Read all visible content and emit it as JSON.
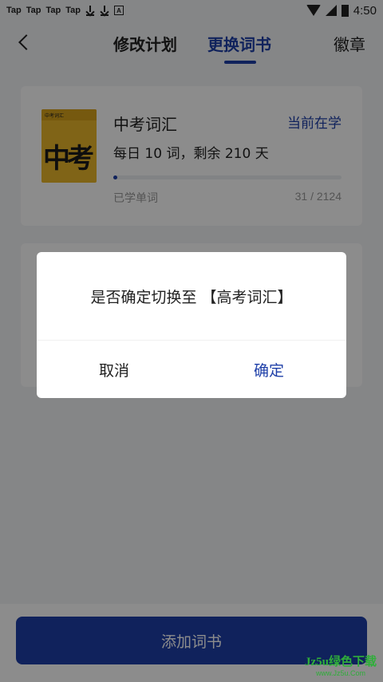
{
  "status_bar": {
    "apps": [
      "Tap",
      "Tap",
      "Tap",
      "Tap"
    ],
    "a_label": "A",
    "time": "4:50"
  },
  "header": {
    "tab_modify": "修改计划",
    "tab_change": "更换词书",
    "tab_badge": "徽章"
  },
  "book": {
    "cover_top_text": "中考词汇",
    "cover_big_text": "中考",
    "title": "中考词汇",
    "status": "当前在学",
    "daily": "每日 10 词，剩余 210 天",
    "learned_label": "已学单词",
    "learned_count": "31 / 2124",
    "progress": 0.0146
  },
  "dialog": {
    "message": "是否确定切换至 【高考词汇】",
    "cancel": "取消",
    "confirm": "确定"
  },
  "footer": {
    "add_button": "添加词书"
  },
  "watermark": {
    "line1": "Jz5u绿色下载",
    "line2": "www.Jz5u.Com"
  },
  "colors": {
    "accent": "#1e3fa8",
    "cover": "#e9b62a"
  }
}
